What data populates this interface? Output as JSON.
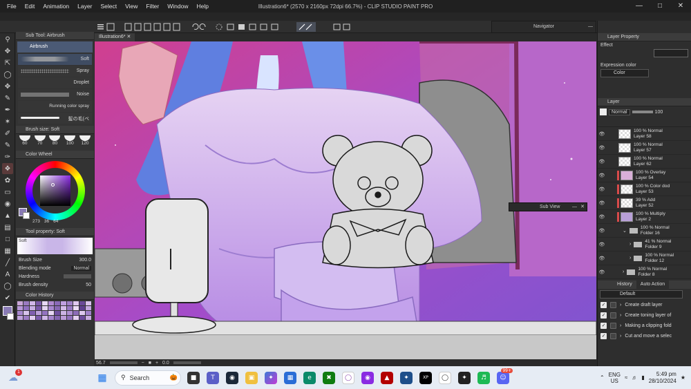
{
  "window": {
    "title": "Illustration6* (2570 x 2160px 72dpi 66.7%) - CLIP STUDIO PAINT PRO",
    "menu": [
      "File",
      "Edit",
      "Animation",
      "Layer",
      "Select",
      "View",
      "Filter",
      "Window",
      "Help"
    ]
  },
  "canvas_tab": "Illustration6*",
  "navigator_title": "Navigator",
  "subview_title": "Sub View",
  "subtool": {
    "header": "Sub Tool: Airbrush",
    "group": "Airbrush",
    "brushes": [
      "Soft",
      "Spray",
      "Droplet",
      "Noise",
      "Running color spray",
      "髪の毛(ベ"
    ]
  },
  "brush_size": {
    "header": "Brush size: Soft",
    "sizes": [
      "60",
      "70",
      "80",
      "100",
      "120"
    ]
  },
  "color_wheel": {
    "header": "Color Wheel",
    "values": [
      "273",
      "36",
      "64"
    ],
    "main_color": "#8a7bb5"
  },
  "tool_property": {
    "header": "Tool property: Soft",
    "preview_label": "Soft",
    "brush_size_label": "Brush Size",
    "brush_size_value": "300.0",
    "blending_label": "Blending mode",
    "blending_value": "Normal",
    "hardness_label": "Hardness",
    "density_label": "Brush density",
    "density_value": "50"
  },
  "color_history_header": "Color History",
  "layer_property": {
    "header": "Layer Property",
    "effect_label": "Effect",
    "expression_label": "Expression color",
    "expression_value": "Color"
  },
  "layer_panel": {
    "header": "Layer",
    "blend": "Normal",
    "opacity": "100",
    "layers": [
      {
        "l1": "100 % Normal",
        "l2": "Layer 58",
        "clip": false
      },
      {
        "l1": "100 % Normal",
        "l2": "Layer 57",
        "clip": false
      },
      {
        "l1": "100 % Normal",
        "l2": "Layer 62",
        "clip": false
      },
      {
        "l1": "100 % Overlay",
        "l2": "Layer 54",
        "clip": true
      },
      {
        "l1": "100 % Color dod",
        "l2": "Layer 53",
        "clip": true
      },
      {
        "l1": "39 % Add",
        "l2": "Layer 52",
        "clip": true
      },
      {
        "l1": "100 % Multiply",
        "l2": "Layer 2",
        "clip": true
      },
      {
        "l1": "100 % Normal",
        "l2": "Folder 16",
        "clip": false,
        "folder": true
      },
      {
        "l1": "41 % Normal",
        "l2": "Folder 9",
        "clip": false,
        "folder": true
      },
      {
        "l1": "100 % Normal",
        "l2": "Folder 12",
        "clip": false,
        "folder": true
      },
      {
        "l1": "100 % Normal",
        "l2": "Folder 8",
        "clip": false,
        "folder": true
      }
    ]
  },
  "history": {
    "tab1": "History",
    "tab2": "Auto Action",
    "set": "Default",
    "actions": [
      "Create draft layer",
      "Create toning layer of",
      "Making a clipping fold",
      "Cut and move a selec"
    ]
  },
  "statusbar": {
    "zoom": "56.7",
    "angle": "0.0"
  },
  "taskbar": {
    "search_placeholder": "Search",
    "lang_line1": "ENG",
    "lang_line2": "US",
    "time": "5:49 pm",
    "date": "28/10/2024",
    "notification_badge": "1",
    "app_badge": "99+"
  }
}
